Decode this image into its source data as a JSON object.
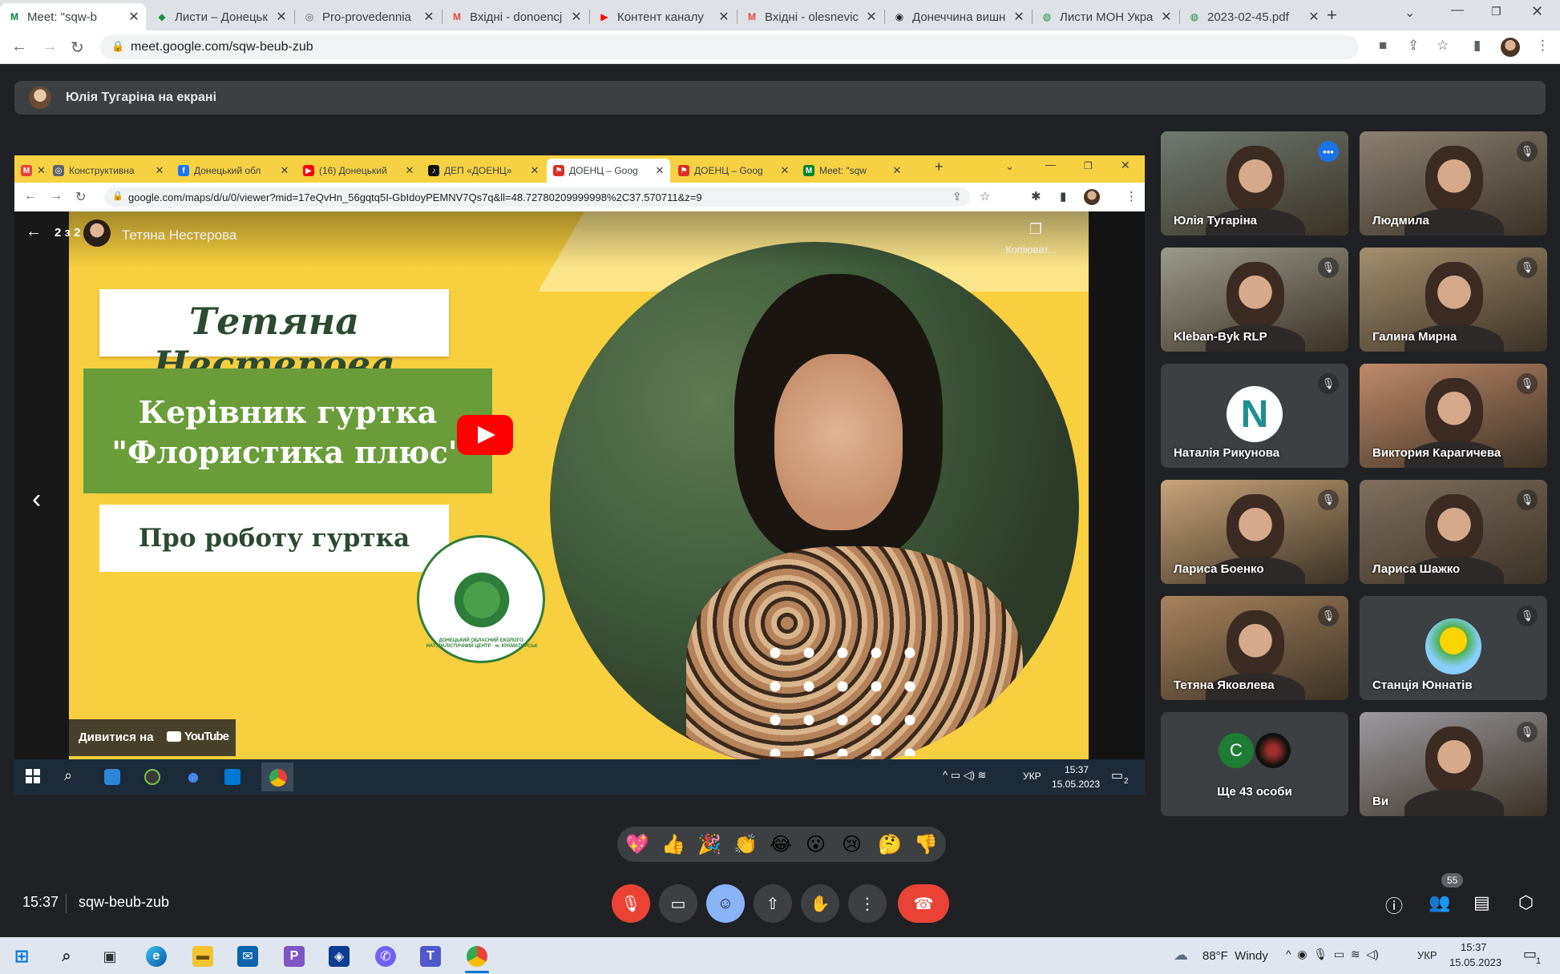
{
  "browser": {
    "tabs": [
      {
        "title": "Meet: \"sqw-b",
        "favicon": "M",
        "fav_color": "#00832d",
        "active": true
      },
      {
        "title": "Листи – Донецьк",
        "favicon": "◆",
        "fav_color": "#1e8e3e"
      },
      {
        "title": "Pro-provedennia",
        "favicon": "◎",
        "fav_color": "#5f6368"
      },
      {
        "title": "Вхідні - donoencj",
        "favicon": "M",
        "fav_color": "#ea4335"
      },
      {
        "title": "Контент каналу",
        "favicon": "▶",
        "fav_color": "#ff0000"
      },
      {
        "title": "Вхідні - olesnevic",
        "favicon": "M",
        "fav_color": "#ea4335"
      },
      {
        "title": "Донеччина вишн",
        "favicon": "◉",
        "fav_color": "#202124"
      },
      {
        "title": "Листи МОН Укра",
        "favicon": "◍",
        "fav_color": "#1e8e3e"
      },
      {
        "title": "2023-02-45.pdf",
        "favicon": "◍",
        "fav_color": "#1e8e3e"
      }
    ],
    "new_tab_label": "+",
    "url": "meet.google.com/sqw-beub-zub"
  },
  "presenter_bar": {
    "label": "Юлія Тугаріна на екрані"
  },
  "shared": {
    "tabs": [
      {
        "title": "",
        "favicon": "M",
        "fav_color": "#ea4335"
      },
      {
        "title": "Конструктивна",
        "favicon": "◎",
        "fav_color": "#5f6368"
      },
      {
        "title": "Донецький обл",
        "favicon": "f",
        "fav_color": "#1877f2"
      },
      {
        "title": "(16) Донецький",
        "favicon": "▶",
        "fav_color": "#ff0000"
      },
      {
        "title": "ДЕП «ДОЕНЦ»",
        "favicon": "♪",
        "fav_color": "#111111"
      },
      {
        "title": "ДОЕНЦ – Goog",
        "favicon": "⚑",
        "fav_color": "#d93025",
        "active": true
      },
      {
        "title": "ДОЕНЦ – Goog",
        "favicon": "⚑",
        "fav_color": "#d93025"
      },
      {
        "title": "Meet: \"sqw",
        "favicon": "M",
        "fav_color": "#00832d"
      }
    ],
    "url": "google.com/maps/d/u/0/viewer?mid=17eQvHn_56gqtq5I-GbIdoyPEMNV7Qs7q&ll=48.72780209999998%2C37.570711&z=9",
    "viewer": {
      "counter": "2 з 2",
      "author": "Тетяна Нестерова",
      "copy_label": "Копіюват...",
      "slide_name": "Тетяна Нестерова",
      "slide_role_line1": "Керівник гуртка",
      "slide_role_line2": "\"Флористика плюс\"",
      "slide_about": "Про роботу гуртка",
      "watch_on": "Дивитися на",
      "youtube": "YouTube",
      "logo_text": "ДОНЕЦЬКИЙ ОБЛАСНИЙ ЕКОЛОГО-НАТУРАЛІСТИЧНИЙ ЦЕНТР · м. КРАМАТОРСЬК"
    },
    "taskbar": {
      "lang": "УКР",
      "time": "15:37",
      "date": "15.05.2023",
      "notif": "2"
    }
  },
  "participants": [
    {
      "name": "Юлія Тугаріна",
      "speaking": true,
      "bg": "#6f7a72"
    },
    {
      "name": "Людмила",
      "muted": true,
      "bg": "#8b8072"
    },
    {
      "name": "Kleban-Byk RLP",
      "muted": true,
      "bg": "#9b9a8c"
    },
    {
      "name": "Галина Мирна",
      "muted": true,
      "bg": "#a48e6e"
    },
    {
      "name": "Наталія Рикунова",
      "muted": true,
      "avatar_letter": "N"
    },
    {
      "name": "Виктория Карагичева",
      "muted": true,
      "bg": "#c08a6a"
    },
    {
      "name": "Лариса Боенко",
      "muted": true,
      "bg": "#c7a478"
    },
    {
      "name": "Лариса Шажко",
      "muted": true,
      "bg": "#7f6f5e"
    },
    {
      "name": "Тетяна Яковлева",
      "muted": true,
      "bg": "#a7835d"
    },
    {
      "name": "Станція Юннатів",
      "muted": true,
      "avatar_letter": ""
    },
    {
      "name": "Ще 43 особи",
      "avatar_letter": "C"
    },
    {
      "name": "Ви",
      "muted": true,
      "bg": "#9c9aa0"
    }
  ],
  "reactions": [
    "💖",
    "👍",
    "🎉",
    "👏",
    "😂",
    "😮",
    "😢",
    "🤔",
    "👎"
  ],
  "bottom": {
    "time": "15:37",
    "meeting_code": "sqw-beub-zub",
    "people_count": "55"
  },
  "win_taskbar": {
    "weather": "88°F  Windy",
    "lang": "УКР",
    "time": "15:37",
    "date": "15.05.2023",
    "notif": "1"
  }
}
